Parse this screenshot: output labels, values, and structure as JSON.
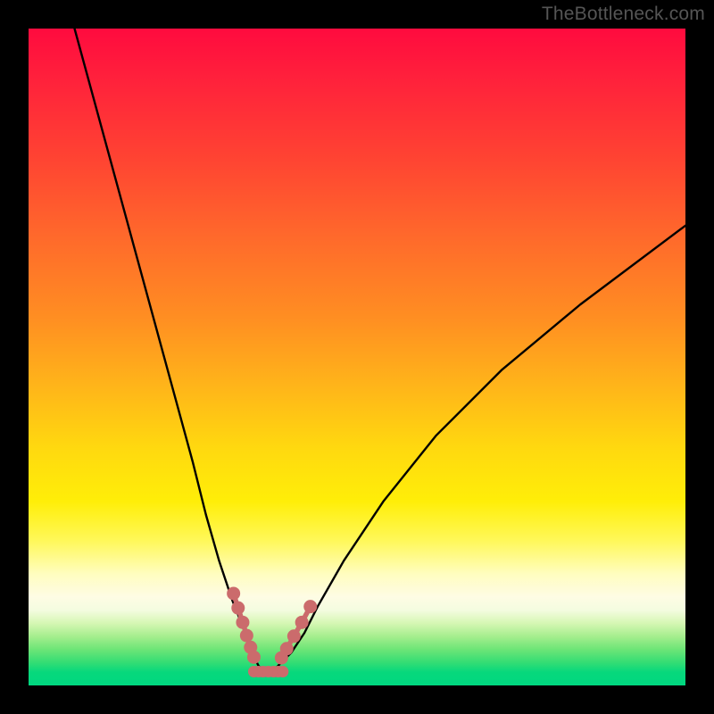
{
  "watermark_text": "TheBottleneck.com",
  "chart_data": {
    "type": "line",
    "title": "",
    "xlabel": "",
    "ylabel": "",
    "xlim": [
      0,
      100
    ],
    "ylim": [
      0,
      100
    ],
    "grid": false,
    "legend": false,
    "series": [
      {
        "name": "bottleneck-curve",
        "x": [
          7,
          10,
          13,
          16,
          19,
          22,
          25,
          27,
          29,
          31,
          33,
          34,
          35,
          36,
          37,
          38,
          40,
          42,
          44,
          48,
          54,
          62,
          72,
          84,
          100
        ],
        "y": [
          100,
          89,
          78,
          67,
          56,
          45,
          34,
          26,
          19,
          13,
          8,
          5,
          3,
          2,
          2,
          3,
          5,
          8,
          12,
          19,
          28,
          38,
          48,
          58,
          70
        ]
      },
      {
        "name": "tolerance-markers-left",
        "x": [
          31.2,
          31.9,
          32.6,
          33.2,
          33.8,
          34.3
        ],
        "y": [
          14.0,
          11.8,
          9.6,
          7.6,
          5.8,
          4.3
        ]
      },
      {
        "name": "tolerance-markers-right",
        "x": [
          38.5,
          39.3,
          40.4,
          41.6,
          42.9
        ],
        "y": [
          4.2,
          5.6,
          7.5,
          9.6,
          12.0
        ]
      },
      {
        "name": "tolerance-markers-bottom",
        "x": [
          34.3,
          35.0,
          35.7,
          36.5,
          37.3,
          38.0,
          38.7
        ],
        "y": [
          2.1,
          2.1,
          2.1,
          2.1,
          2.1,
          2.1,
          2.1
        ]
      }
    ],
    "gradient_stops": [
      {
        "pos": 0.0,
        "color": "#ff0b3e"
      },
      {
        "pos": 0.2,
        "color": "#ff4432"
      },
      {
        "pos": 0.44,
        "color": "#ff8e22"
      },
      {
        "pos": 0.64,
        "color": "#ffd90f"
      },
      {
        "pos": 0.83,
        "color": "#fffdbf"
      },
      {
        "pos": 0.93,
        "color": "#a6ee8e"
      },
      {
        "pos": 1.0,
        "color": "#00d780"
      }
    ],
    "marker_color": "#cb6b6c",
    "curve_color": "#000000"
  }
}
